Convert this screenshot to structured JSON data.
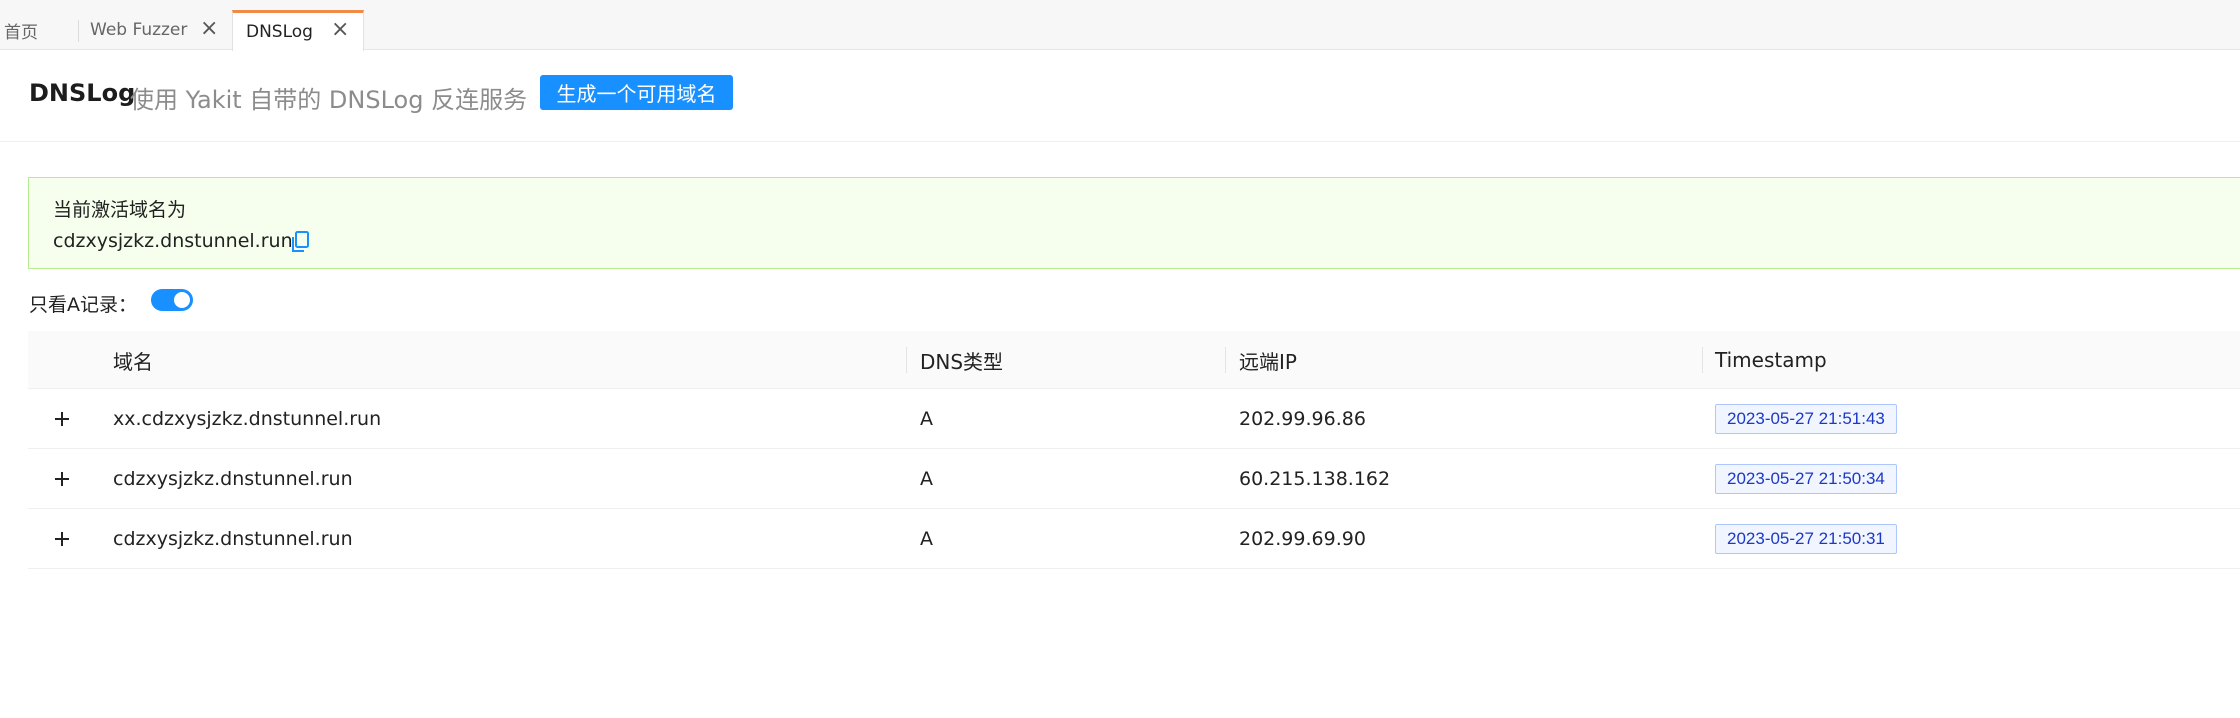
{
  "tabs": [
    {
      "label": "首页",
      "closable": false,
      "active": false
    },
    {
      "label": "Web Fuzzer",
      "closable": true,
      "active": false
    },
    {
      "label": "DNSLog",
      "closable": true,
      "active": true
    }
  ],
  "header": {
    "title": "DNSLog",
    "subtitle": "使用 Yakit 自带的 DNSLog 反连服务",
    "generate_button": "生成一个可用域名"
  },
  "alert": {
    "title": "当前激活域名为",
    "domain": "cdzxysjzkz.dnstunnel.run"
  },
  "filter": {
    "label": "只看A记录：",
    "enabled": true
  },
  "table": {
    "columns": [
      "域名",
      "DNS类型",
      "远端IP",
      "Timestamp"
    ],
    "rows": [
      {
        "domain": "xx.cdzxysjzkz.dnstunnel.run",
        "type": "A",
        "ip": "202.99.96.86",
        "timestamp": "2023-05-27 21:51:43"
      },
      {
        "domain": "cdzxysjzkz.dnstunnel.run",
        "type": "A",
        "ip": "60.215.138.162",
        "timestamp": "2023-05-27 21:50:34"
      },
      {
        "domain": "cdzxysjzkz.dnstunnel.run",
        "type": "A",
        "ip": "202.99.69.90",
        "timestamp": "2023-05-27 21:50:31"
      }
    ]
  },
  "colors": {
    "accent": "#1890ff",
    "active_tab_border": "#f08a46",
    "alert_bg": "#f6ffed",
    "alert_border": "#b7eb8f",
    "tag_text": "#1d39c4"
  }
}
